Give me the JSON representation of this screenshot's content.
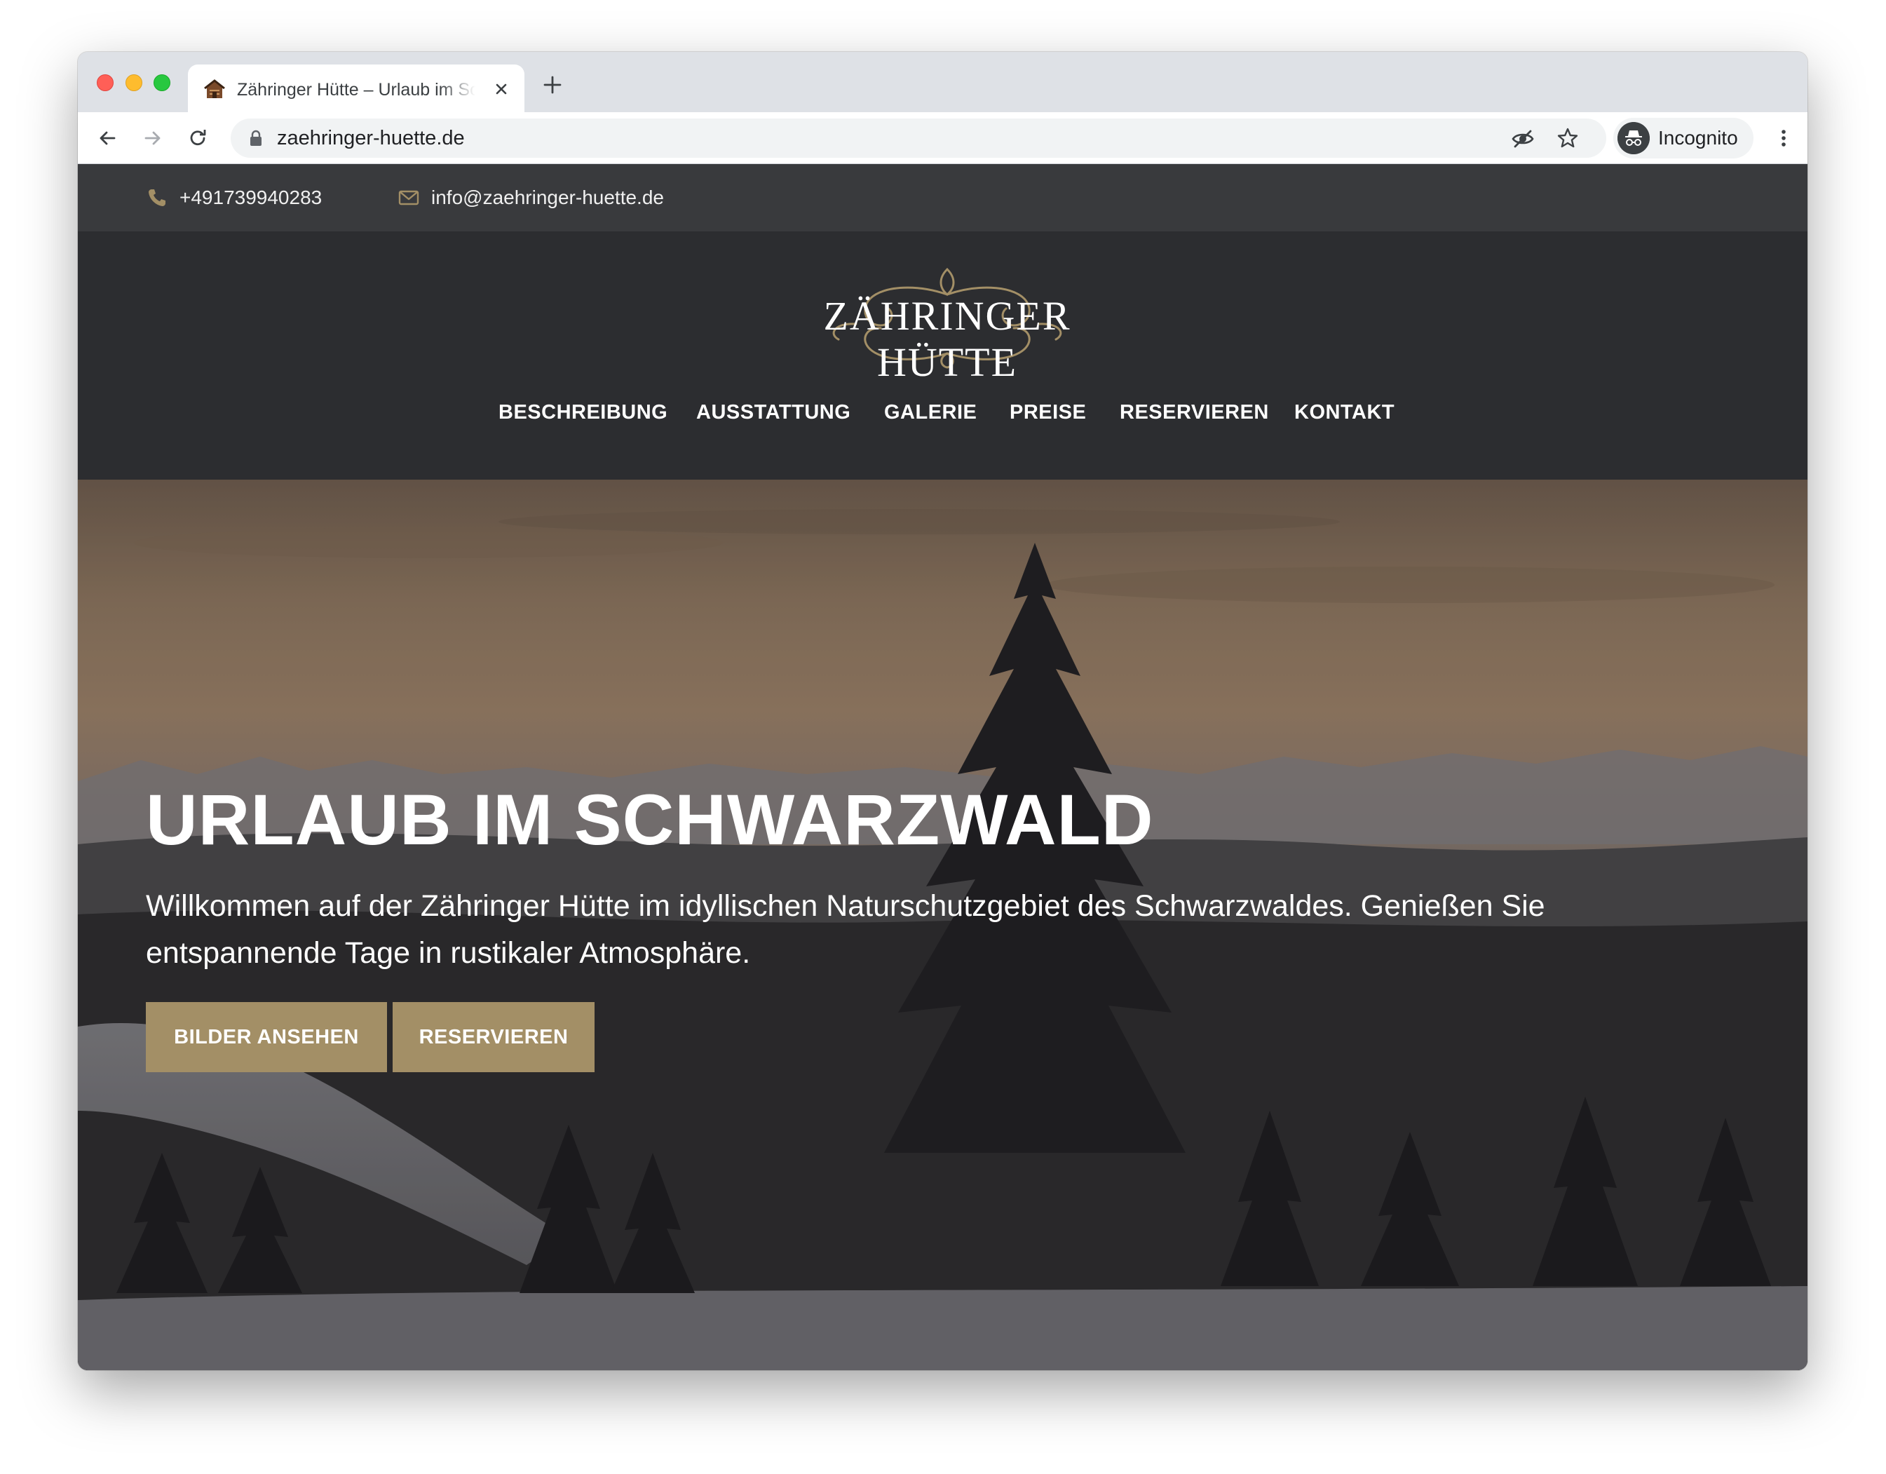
{
  "browser": {
    "tab_title": "Zähringer Hütte – Urlaub im Schwarzwald",
    "url": "zaehringer-huette.de",
    "profile_label": "Incognito"
  },
  "topbar": {
    "phone": "+491739940283",
    "email": "info@zaehringer-huette.de"
  },
  "header": {
    "logo_text": "ZÄHRINGER HÜTTE",
    "nav": [
      {
        "label": "BESCHREIBUNG"
      },
      {
        "label": "AUSSTATTUNG"
      },
      {
        "label": "GALERIE"
      },
      {
        "label": "PREISE"
      },
      {
        "label": "RESERVIEREN"
      },
      {
        "label": "KONTAKT"
      }
    ]
  },
  "hero": {
    "title": "URLAUB IM SCHWARZWALD",
    "text": "Willkommen auf der Zähringer Hütte im idyllischen Naturschutzgebiet des Schwarzwaldes. Genießen Sie entspannende Tage in rustikaler Atmosphäre.",
    "button_gallery": "BILDER ANSEHEN",
    "button_reserve": "RESERVIEREN"
  },
  "colors": {
    "accent": "#a38f66",
    "topbar_bg": "#393a3d",
    "header_bg": "#2c2d30"
  }
}
